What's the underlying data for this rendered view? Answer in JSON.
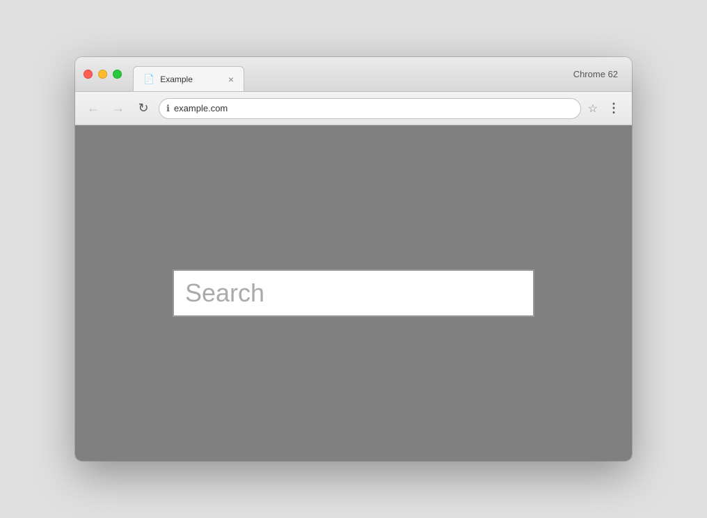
{
  "browser": {
    "title": "Chrome 62",
    "tab": {
      "icon": "📄",
      "title": "Example",
      "close": "×"
    },
    "address": "example.com",
    "nav": {
      "back": "←",
      "forward": "→",
      "reload": "↻"
    },
    "star": "☆",
    "menu": "⋮"
  },
  "page": {
    "search_placeholder": "Search"
  }
}
